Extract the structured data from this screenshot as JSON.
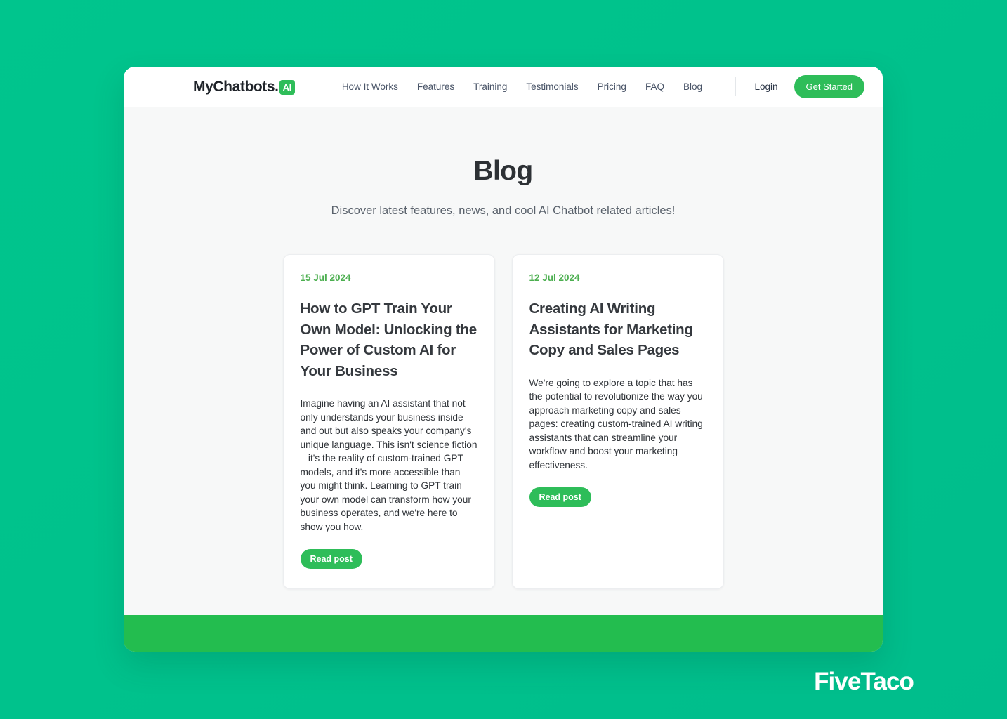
{
  "navbar": {
    "brand": {
      "name": "MyChatbots",
      "dot": ".",
      "badge": "AI"
    },
    "links": [
      {
        "label": "How It Works"
      },
      {
        "label": "Features"
      },
      {
        "label": "Training"
      },
      {
        "label": "Testimonials"
      },
      {
        "label": "Pricing"
      },
      {
        "label": "FAQ"
      },
      {
        "label": "Blog"
      }
    ],
    "login_label": "Login",
    "cta_label": "Get Started"
  },
  "hero": {
    "title": "Blog",
    "subtitle": "Discover latest features, news, and cool AI Chatbot related articles!"
  },
  "posts": [
    {
      "date": "15 Jul 2024",
      "title": "How to GPT Train Your Own Model: Unlocking the Power of Custom AI for Your Business",
      "excerpt": "Imagine having an AI assistant that not only understands your business inside and out but also speaks your company's unique language. This isn't science fiction – it's the reality of custom-trained GPT models, and it's more accessible than you might think. Learning to GPT train your own model can transform how your business operates, and we're here to show you how.",
      "cta_label": "Read post"
    },
    {
      "date": "12 Jul 2024",
      "title": "Creating AI Writing Assistants for Marketing Copy and Sales Pages",
      "excerpt": "We're going to explore a topic that has the potential to revolutionize the way you approach marketing copy and sales pages: creating custom-trained AI writing assistants that can streamline your workflow and boost your marketing effectiveness.",
      "cta_label": "Read post"
    }
  ],
  "watermark": "FiveTaco",
  "colors": {
    "page_background": "#00c38c",
    "brand_green": "#2ebd59",
    "date_green": "#4caf50",
    "footer_green": "#23bd4f",
    "section_background": "#f7f8f8"
  }
}
